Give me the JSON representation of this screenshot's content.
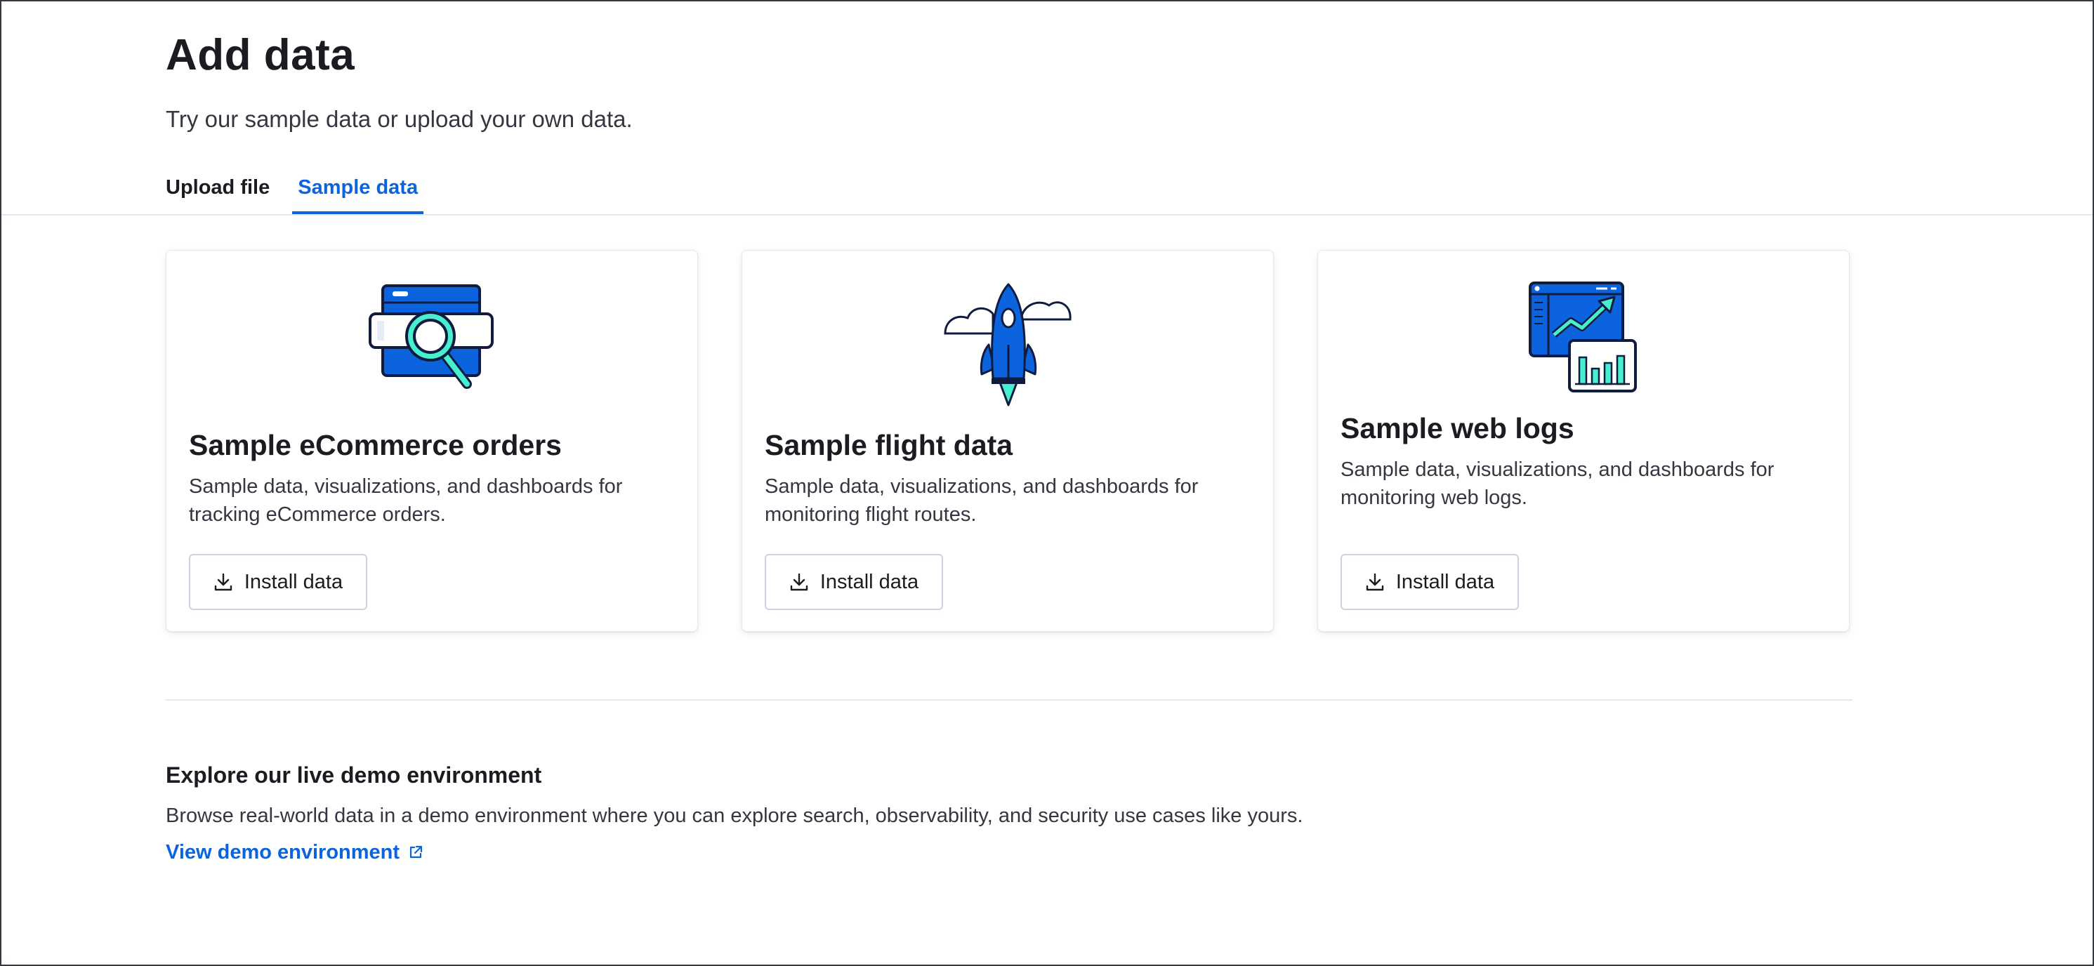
{
  "header": {
    "title": "Add data",
    "description": "Try our sample data or upload your own data."
  },
  "tabs": [
    {
      "label": "Upload file",
      "active": false
    },
    {
      "label": "Sample data",
      "active": true
    }
  ],
  "cards": [
    {
      "title": "Sample eCommerce orders",
      "description": "Sample data, visualizations, and dashboards for tracking eCommerce orders.",
      "button_label": "Install data",
      "illustration": "ecommerce-search-illustration"
    },
    {
      "title": "Sample flight data",
      "description": "Sample data, visualizations, and dashboards for monitoring flight routes.",
      "button_label": "Install data",
      "illustration": "rocket-clouds-illustration"
    },
    {
      "title": "Sample web logs",
      "description": "Sample data, visualizations, and dashboards for monitoring web logs.",
      "button_label": "Install data",
      "illustration": "web-logs-dashboard-illustration"
    }
  ],
  "demo": {
    "title": "Explore our live demo environment",
    "description": "Browse real-world data in a demo environment where you can explore search, observability, and security use cases like yours.",
    "link_label": "View demo environment"
  },
  "colors": {
    "accent": "#0b64dd",
    "illustration_blue": "#0b64dd",
    "illustration_teal": "#48efcf",
    "illustration_navy": "#101c3f",
    "text": "#1a1c21"
  }
}
